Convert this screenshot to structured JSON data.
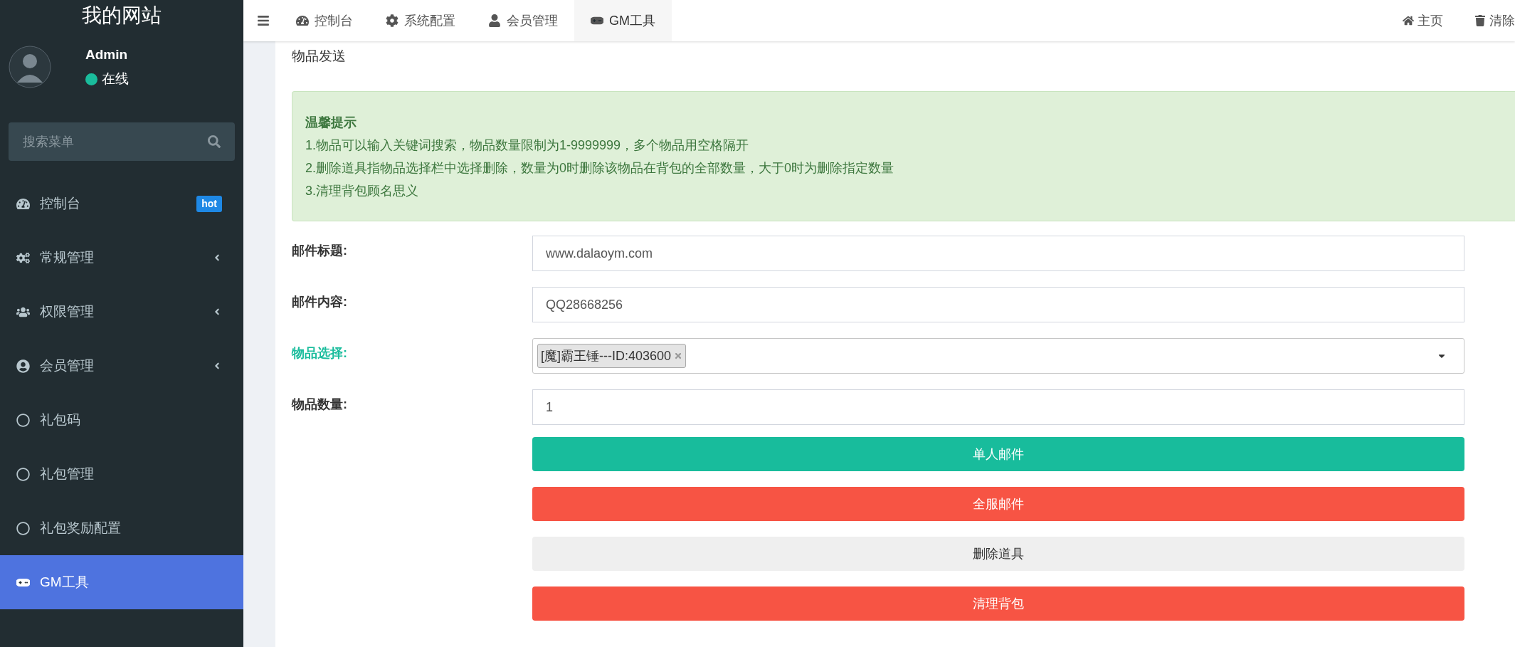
{
  "sidebar": {
    "site_title": "我的网站",
    "user": {
      "name": "Admin",
      "status": "在线"
    },
    "search": {
      "placeholder": "搜索菜单"
    },
    "items": [
      {
        "label": "控制台",
        "badge": "hot",
        "has_submenu": false,
        "selected": false
      },
      {
        "label": "常规管理",
        "has_submenu": true,
        "selected": false
      },
      {
        "label": "权限管理",
        "has_submenu": true,
        "selected": false
      },
      {
        "label": "会员管理",
        "has_submenu": true,
        "selected": false
      },
      {
        "label": "礼包码",
        "has_submenu": false,
        "selected": false
      },
      {
        "label": "礼包管理",
        "has_submenu": false,
        "selected": false
      },
      {
        "label": "礼包奖励配置",
        "has_submenu": false,
        "selected": false
      },
      {
        "label": "GM工具",
        "has_submenu": false,
        "selected": true
      }
    ]
  },
  "top_nav": {
    "tabs": [
      {
        "label": "控制台",
        "selected": false
      },
      {
        "label": "系统配置",
        "selected": false
      },
      {
        "label": "会员管理",
        "selected": false
      },
      {
        "label": "GM工具",
        "selected": true
      }
    ],
    "right_links": [
      "主页",
      "清除"
    ]
  },
  "page": {
    "title": "物品发送",
    "alert": {
      "title": "温馨提示",
      "lines": [
        "1.物品可以输入关键词搜索，物品数量限制为1-9999999，多个物品用空格隔开",
        "2.删除道具指物品选择栏中选择删除，数量为0时删除该物品在背包的全部数量，大于0时为删除指定数量",
        "3.清理背包顾名思义"
      ]
    },
    "fields": [
      {
        "kind": "text",
        "label": "邮件标题:",
        "value": "www.dalaoym.com",
        "focused": false
      },
      {
        "kind": "text",
        "label": "邮件内容:",
        "value": "QQ28668256",
        "focused": false
      },
      {
        "kind": "select",
        "label": "物品选择:",
        "tags": [
          "[魔]霸王锤---ID:403600"
        ],
        "focused": true
      },
      {
        "kind": "text",
        "label": "物品数量:",
        "value": "1",
        "focused": false
      }
    ],
    "buttons": [
      {
        "label": "单人邮件",
        "kind": "success"
      },
      {
        "label": "全服邮件",
        "kind": "danger"
      },
      {
        "label": "删除道具",
        "kind": "default"
      },
      {
        "label": "清理背包",
        "kind": "danger"
      }
    ]
  }
}
